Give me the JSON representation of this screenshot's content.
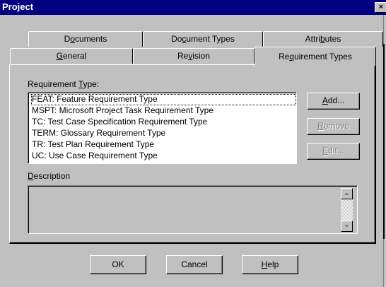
{
  "window": {
    "title": "Project",
    "close_glyph": "×"
  },
  "tabs": {
    "back_row": [
      {
        "pre": "D",
        "key": "o",
        "post": "cuments"
      },
      {
        "pre": "Do",
        "key": "c",
        "post": "ument Types"
      },
      {
        "pre": "Attri",
        "key": "b",
        "post": "utes"
      }
    ],
    "front_row": [
      {
        "pre": "",
        "key": "G",
        "post": "eneral"
      },
      {
        "pre": "Re",
        "key": "v",
        "post": "ision"
      },
      {
        "pre": "Re",
        "key": "q",
        "post": "uirement Types"
      }
    ]
  },
  "requirement_type": {
    "label_pre": "Requirement ",
    "label_key": "T",
    "label_post": "ype:",
    "items": [
      "FEAT: Feature Requirement Type",
      "MSPT: Microsoft Project Task Requirement Type",
      "TC: Test Case Specification Requirement Type",
      "TERM: Glossary Requirement Type",
      "TR: Test Plan Requirement Type",
      "UC: Use Case Requirement Type"
    ]
  },
  "side_buttons": {
    "add": {
      "key": "A",
      "post": "dd..."
    },
    "remove": {
      "key": "R",
      "post": "emove"
    },
    "edit": {
      "key": "E",
      "post": "dit..."
    }
  },
  "description": {
    "label_key": "D",
    "label_post": "escription",
    "value": ""
  },
  "footer": {
    "ok": "OK",
    "cancel": "Cancel",
    "help_key": "H",
    "help_post": "elp"
  }
}
